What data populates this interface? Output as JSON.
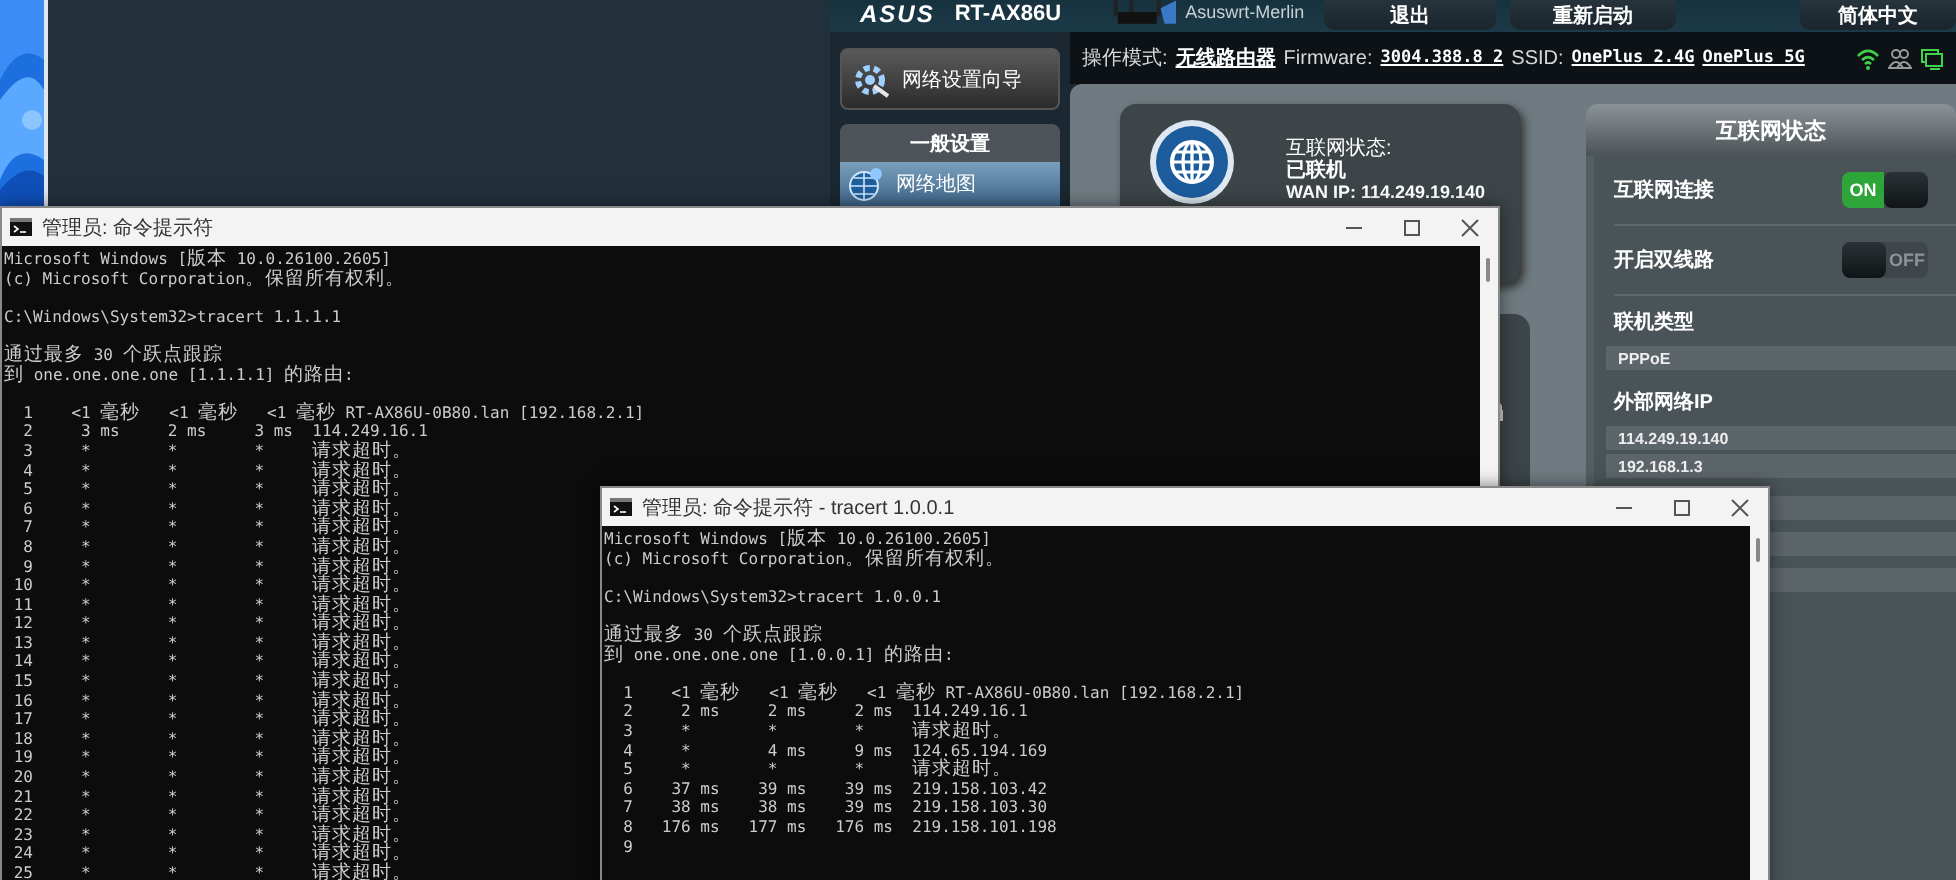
{
  "router_page": {
    "header": {
      "logo": "ASUS",
      "model": "RT-AX86U",
      "firmware_name": "Asuswrt-Merlin",
      "buttons": [
        "退出",
        "重新启动",
        "简体中文"
      ]
    },
    "status_line": {
      "mode_label": "操作模式:",
      "mode": "无线路由器",
      "firmware_label": "Firmware:",
      "firmware": "3004.388.8_2",
      "ssid_label": "SSID:",
      "ssids": [
        "OnePlus_2.4G",
        "OnePlus_5G"
      ]
    },
    "sidebar": {
      "wizard": "网络设置向导",
      "section": "一般设置",
      "items": [
        {
          "label": "网络地图",
          "selected": true
        }
      ]
    },
    "internet_card": {
      "status_label": "互联网状态:",
      "status": "已联机",
      "wan_ip": "WAN IP: 114.249.19.140"
    },
    "status_panel": {
      "title": "互联网状态",
      "rows": [
        {
          "kind": "toggle",
          "label": "互联网连接",
          "on": true,
          "toggle_label": "ON"
        },
        {
          "kind": "toggle",
          "label": "开启双线路",
          "on": false,
          "toggle_label": "OFF"
        },
        {
          "kind": "values",
          "label": "联机类型",
          "values": [
            "PPPoE"
          ]
        },
        {
          "kind": "values",
          "label": "外部网络IP",
          "values": [
            "114.249.19.140",
            "192.168.1.3"
          ]
        }
      ]
    }
  },
  "windows": [
    {
      "title": "管理员: 命令提示符",
      "blocks": [
        [
          "Microsoft Windows [版本 10.0.26100.2605]",
          "(c) Microsoft Corporation。保留所有权利。"
        ],
        [
          "C:\\Windows\\System32>tracert 1.1.1.1"
        ],
        [
          "通过最多 30 个跃点跟踪",
          "到 one.one.one.one [1.1.1.1] 的路由:"
        ],
        [
          "  1    <1 毫秒   <1 毫秒   <1 毫秒 RT-AX86U-0B80.lan [192.168.2.1]",
          "  2     3 ms     2 ms     3 ms  114.249.16.1",
          "  3     *        *        *     请求超时。",
          "  4     *        *        *     请求超时。",
          "  5     *        *        *     请求超时。",
          "  6     *        *        *     请求超时。",
          "  7     *        *        *     请求超时。",
          "  8     *        *        *     请求超时。",
          "  9     *        *        *     请求超时。",
          " 10     *        *        *     请求超时。",
          " 11     *        *        *     请求超时。",
          " 12     *        *        *     请求超时。",
          " 13     *        *        *     请求超时。",
          " 14     *        *        *     请求超时。",
          " 15     *        *        *     请求超时。",
          " 16     *        *        *     请求超时。",
          " 17     *        *        *     请求超时。",
          " 18     *        *        *     请求超时。",
          " 19     *        *        *     请求超时。",
          " 20     *        *        *     请求超时。",
          " 21     *        *        *     请求超时。",
          " 22     *        *        *     请求超时。",
          " 23     *        *        *     请求超时。",
          " 24     *        *        *     请求超时。",
          " 25     *        *        *     请求超时。"
        ]
      ]
    },
    {
      "title": "管理员: 命令提示符 - tracert  1.0.0.1",
      "blocks": [
        [
          "Microsoft Windows [版本 10.0.26100.2605]",
          "(c) Microsoft Corporation。保留所有权利。"
        ],
        [
          "C:\\Windows\\System32>tracert 1.0.0.1"
        ],
        [
          "通过最多 30 个跃点跟踪",
          "到 one.one.one.one [1.0.0.1] 的路由:"
        ],
        [
          "  1    <1 毫秒   <1 毫秒   <1 毫秒 RT-AX86U-0B80.lan [192.168.2.1]",
          "  2     2 ms     2 ms     2 ms  114.249.16.1",
          "  3     *        *        *     请求超时。",
          "  4     *        4 ms     9 ms  124.65.194.169",
          "  5     *        *        *     请求超时。",
          "  6    37 ms    39 ms    39 ms  219.158.103.42",
          "  7    38 ms    38 ms    39 ms  219.158.103.30",
          "  8   176 ms   177 ms   176 ms  219.158.101.198",
          "  9"
        ]
      ]
    }
  ]
}
